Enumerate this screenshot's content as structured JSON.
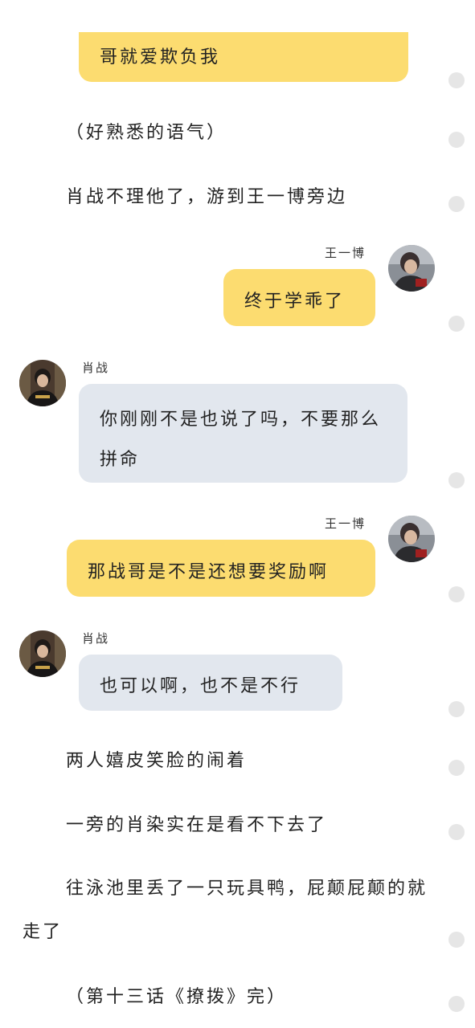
{
  "messages": {
    "top_partial": "哥就爱欺负我",
    "m1": "终于学乖了",
    "m2": "你刚刚不是也说了吗，不要那么拼命",
    "m3": "那战哥是不是还想要奖励啊",
    "m4": "也可以啊，也不是不行"
  },
  "speakers": {
    "wang": "王一博",
    "xiao": "肖战"
  },
  "narration": {
    "n1": "（好熟悉的语气）",
    "n2": "肖战不理他了，游到王一博旁边",
    "n3": "两人嬉皮笑脸的闹着",
    "n4": "一旁的肖染实在是看不下去了",
    "n5": "往泳池里丢了一只玩具鸭，屁颠屁颠的就走了",
    "n6": "（第十三话《撩拨》完）"
  },
  "colors": {
    "bubble_yellow": "#fcdc70",
    "bubble_gray": "#e2e7ee",
    "rail_dot": "#e6e6e6"
  }
}
